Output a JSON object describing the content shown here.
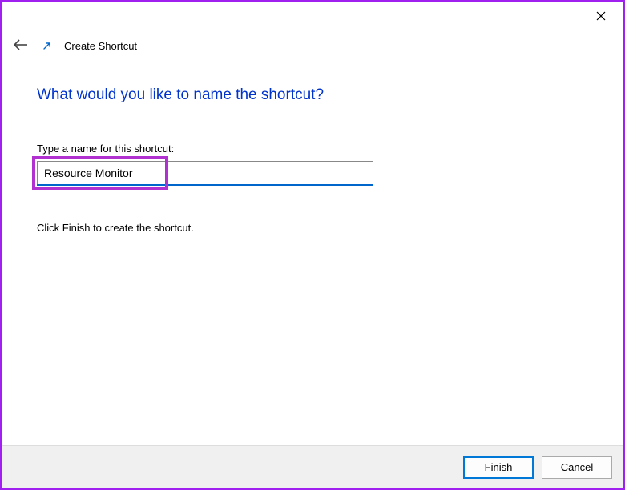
{
  "header": {
    "title": "Create Shortcut"
  },
  "main": {
    "heading": "What would you like to name the shortcut?",
    "prompt_label": "Type a name for this shortcut:",
    "name_value": "Resource Monitor",
    "instruction": "Click Finish to create the shortcut."
  },
  "footer": {
    "finish_label": "Finish",
    "cancel_label": "Cancel"
  },
  "colors": {
    "accent": "#0078d7",
    "heading": "#0033cc",
    "annotation": "#a020f0"
  }
}
